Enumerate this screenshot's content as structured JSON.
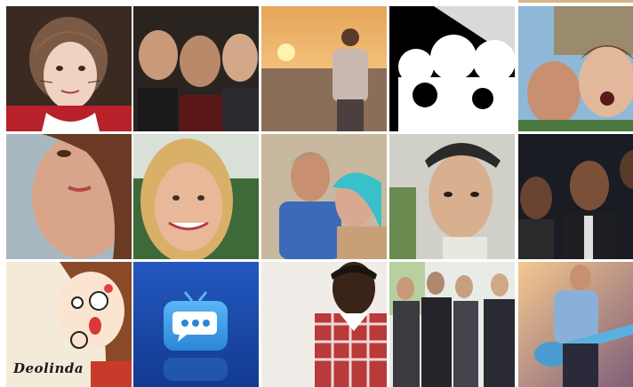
{
  "grid": {
    "tiles": [
      {
        "name": "avatar-girl-cat-whiskers"
      },
      {
        "name": "avatar-band-three-men"
      },
      {
        "name": "avatar-man-sunset"
      },
      {
        "name": "avatar-bw-abstract"
      },
      {
        "name": "avatar-two-friends-selfie"
      },
      {
        "name": "avatar-woman-closeup"
      },
      {
        "name": "avatar-blonde-woman"
      },
      {
        "name": "avatar-couple-blue-hair"
      },
      {
        "name": "avatar-young-man-cap"
      },
      {
        "name": "avatar-three-men-dark"
      },
      {
        "name": "avatar-cartoon-girl",
        "caption": "Deolinda"
      },
      {
        "name": "avatar-tv-chat-icon"
      },
      {
        "name": "avatar-man-plaid-shirt"
      },
      {
        "name": "avatar-band-outdoor"
      },
      {
        "name": "avatar-guitarist-stage"
      }
    ]
  },
  "colors": {
    "tv_icon_bg": "#1a4fb3",
    "tv_icon_screen": "#3a9ce8"
  }
}
